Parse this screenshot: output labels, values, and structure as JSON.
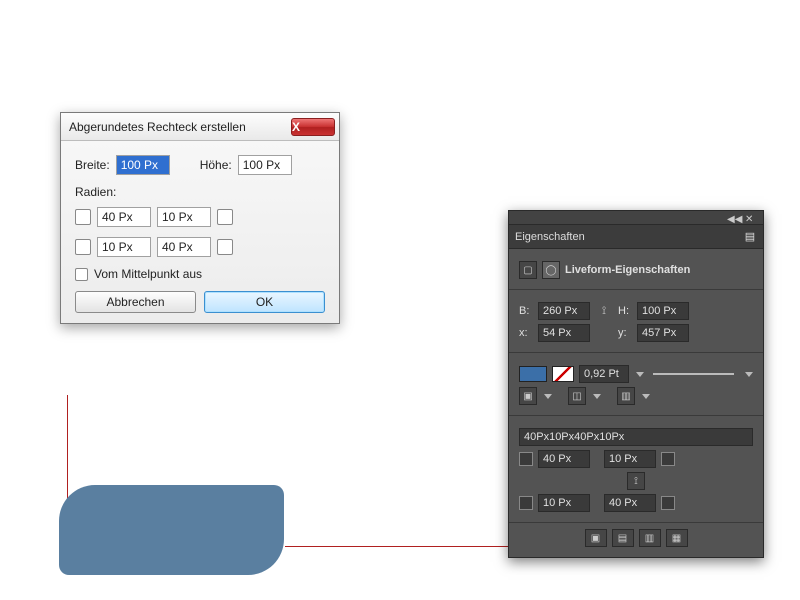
{
  "dialog": {
    "title": "Abgerundetes Rechteck erstellen",
    "close": "X",
    "width_label": "Breite:",
    "width_value": "100 Px",
    "height_label": "Höhe:",
    "height_value": "100 Px",
    "radii_label": "Radien:",
    "r_tl": "40 Px",
    "r_tr": "10 Px",
    "r_bl": "10 Px",
    "r_br": "40 Px",
    "from_center_label": "Vom Mittelpunkt aus",
    "cancel": "Abbrechen",
    "ok": "OK"
  },
  "panel": {
    "tab": "Eigenschaften",
    "heading": "Liveform-Eigenschaften",
    "w_label": "B:",
    "w_value": "260 Px",
    "h_label": "H:",
    "h_value": "100 Px",
    "x_label": "x:",
    "x_value": "54 Px",
    "y_label": "y:",
    "y_value": "457 Px",
    "stroke_weight": "0,92 Pt",
    "radii_text": "40Px10Px40Px10Px",
    "r_tl": "40 Px",
    "r_tr": "10 Px",
    "r_bl": "10 Px",
    "r_br": "40 Px"
  }
}
